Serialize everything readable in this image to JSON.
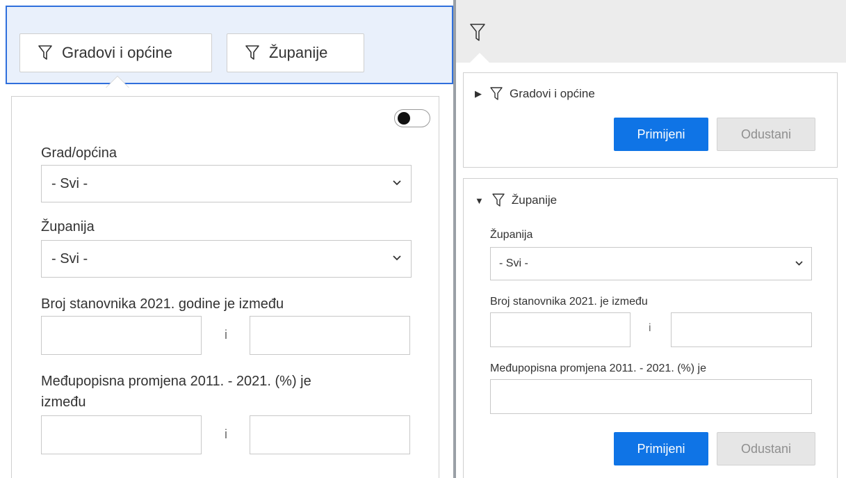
{
  "left": {
    "tabs": [
      {
        "label": "Gradovi i općine",
        "icon": "filter-icon"
      },
      {
        "label": "Županije",
        "icon": "filter-icon"
      }
    ],
    "toggle_on": false,
    "fields": {
      "grad_label": "Grad/općina",
      "grad_value": "- Svi -",
      "zupanija_label": "Županija",
      "zupanija_value": "- Svi -",
      "broj_label": "Broj stanovnika 2021. godine je između",
      "broj_sep": "i",
      "promjena_label_1": "Međupopisna promjena 2011. - 2021. (%) je",
      "promjena_label_2": "između",
      "promjena_sep": "i"
    }
  },
  "right": {
    "header_icon": "filter-icon",
    "card1": {
      "expand_icon": "▶",
      "title": "Gradovi i općine",
      "apply_label": "Primijeni",
      "cancel_label": "Odustani"
    },
    "card2": {
      "expand_icon": "▼",
      "title": "Županije",
      "zupanija_label": "Županija",
      "zupanija_value": "- Svi -",
      "broj_label": "Broj stanovnika 2021. je između",
      "broj_sep": "i",
      "promjena_label": "Međupopisna promjena 2011. - 2021. (%) je",
      "apply_label": "Primijeni",
      "cancel_label": "Odustani"
    }
  },
  "colors": {
    "accent": "#0f74e6",
    "selected_border": "#2f6fdc",
    "selected_bg": "#e9f0fb"
  }
}
